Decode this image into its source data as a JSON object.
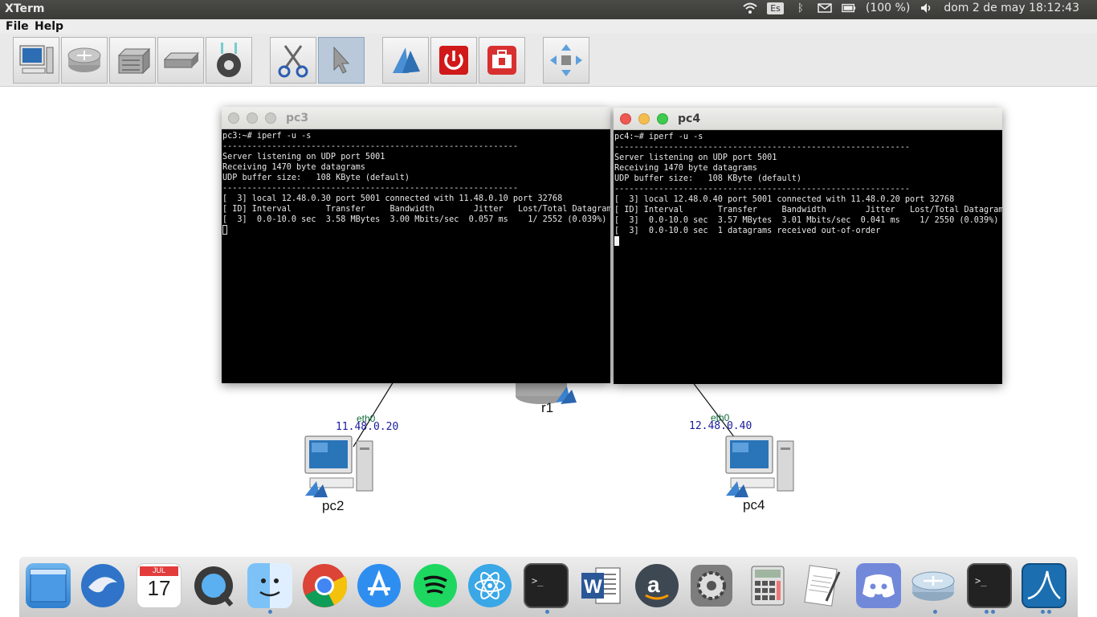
{
  "topbar": {
    "app_name": "XTerm",
    "keyboard_layout": "Es",
    "battery": "(100 %)",
    "datetime": "dom  2 de may 18:12:43",
    "icons": [
      "wifi-icon",
      "bluetooth-icon",
      "mail-icon",
      "battery-icon",
      "volume-icon"
    ]
  },
  "menu": {
    "file": "File",
    "help": "Help"
  },
  "toolbar": {
    "tools": [
      "host",
      "router",
      "switch",
      "hub",
      "wireless-ap",
      "cut-link",
      "select",
      "start",
      "stop",
      "restart",
      "center-view"
    ],
    "active_tool": "select"
  },
  "network": {
    "nodes": [
      {
        "id": "r1",
        "label": "r1"
      },
      {
        "id": "pc2",
        "label": "pc2",
        "iface": "eth0",
        "ip": "11.48.0.20"
      },
      {
        "id": "pc4",
        "label": "pc4",
        "iface": "eth0",
        "ip": "12.48.0.40"
      }
    ]
  },
  "windows": {
    "pc3": {
      "title": "pc3",
      "lines": [
        "pc3:~# iperf -u -s",
        "------------------------------------------------------------",
        "Server listening on UDP port 5001",
        "Receiving 1470 byte datagrams",
        "UDP buffer size:   108 KByte (default)",
        "------------------------------------------------------------",
        "[  3] local 12.48.0.30 port 5001 connected with 11.48.0.10 port 32768",
        "[ ID] Interval       Transfer     Bandwidth        Jitter   Lost/Total Datagrams",
        "[  3]  0.0-10.0 sec  3.58 MBytes  3.00 Mbits/sec  0.057 ms    1/ 2552 (0.039%)"
      ]
    },
    "pc4": {
      "title": "pc4",
      "lines": [
        "pc4:~# iperf -u -s",
        "------------------------------------------------------------",
        "Server listening on UDP port 5001",
        "Receiving 1470 byte datagrams",
        "UDP buffer size:   108 KByte (default)",
        "------------------------------------------------------------",
        "[  3] local 12.48.0.40 port 5001 connected with 11.48.0.20 port 32768",
        "[ ID] Interval       Transfer     Bandwidth        Jitter   Lost/Total Datagrams",
        "[  3]  0.0-10.0 sec  3.57 MBytes  3.01 Mbits/sec  0.041 ms    1/ 2550 (0.039%)",
        "[  3]  0.0-10.0 sec  1 datagrams received out-of-order"
      ]
    }
  },
  "dock": {
    "calendar_month": "JUL",
    "calendar_day": "17",
    "items": [
      "show-desktop",
      "thunderbird",
      "calendar",
      "quicktime",
      "finder",
      "chrome",
      "app-store",
      "spotify",
      "atom",
      "terminal",
      "word",
      "amazon",
      "system-preferences",
      "calculator",
      "text-editor",
      "discord",
      "imunes",
      "xterm",
      "wireshark"
    ]
  },
  "colors": {
    "topbar": "#3a3a37",
    "toolbar": "#e9e9e9",
    "ip_label": "#1a1aa0",
    "iface_label": "#0f6b3a",
    "close": "#ee5a52",
    "minimize": "#f4be4f",
    "maximize": "#3ec94f"
  }
}
